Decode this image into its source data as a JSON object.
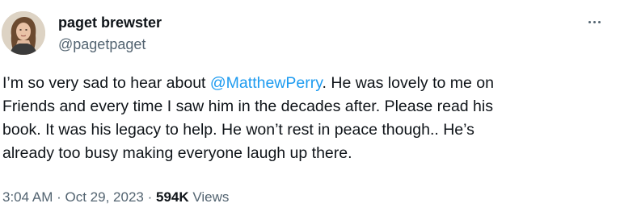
{
  "author": {
    "display_name": "paget brewster",
    "handle": "@pagetpaget",
    "avatar_icon": "user-avatar-photo"
  },
  "more_icon": "more-horizontal-icon",
  "tweet": {
    "lines": [
      {
        "before": "I’m so very sad to hear about ",
        "mention": "@MatthewPerry",
        "after": ".  He was lovely to me on"
      },
      {
        "text": "Friends and every time I saw him in the decades after. Please read his"
      },
      {
        "text": "book. It was his legacy to help. He won’t rest in peace though.. He’s"
      },
      {
        "text": "already too busy making everyone laugh up there."
      }
    ]
  },
  "meta": {
    "time": "3:04 AM",
    "separator": "·",
    "date": "Oct 29, 2023",
    "views_count": "594K",
    "views_label": "Views"
  },
  "colors": {
    "text": "#0f1419",
    "secondary": "#536471",
    "link": "#1d9bf0"
  }
}
